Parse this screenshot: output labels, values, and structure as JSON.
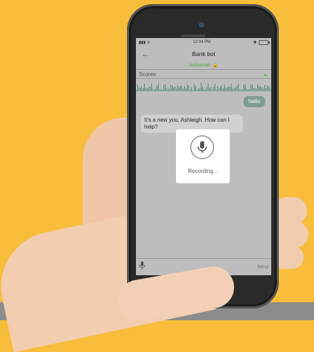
{
  "status_bar": {
    "time": "12:04 PM"
  },
  "header": {
    "title": "Bank bot",
    "back_icon": "back-arrow-icon"
  },
  "auth": {
    "label": "Authorized",
    "icon": "lock-open-icon"
  },
  "scores": {
    "label": "Scores",
    "icon": "chevron-down-icon"
  },
  "messages": [
    {
      "from": "user",
      "text": "hello"
    },
    {
      "from": "bot",
      "text": "It's a new you, Ashleigh. How can I help?"
    }
  ],
  "recording": {
    "label": "Recording...",
    "icon": "microphone-icon"
  },
  "input": {
    "mic_icon": "microphone-icon",
    "send_label": "Send"
  },
  "colors": {
    "background": "#F8BD3B",
    "accent_green": "#3DAA32",
    "user_bubble": "#7E9C93",
    "bot_bubble": "#D1D1D1"
  }
}
